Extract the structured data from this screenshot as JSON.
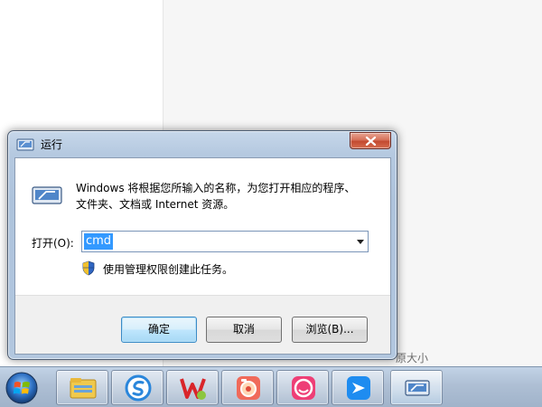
{
  "desktop": {
    "partial_text": "原大小"
  },
  "dialog": {
    "title": "运行",
    "description_line1": "Windows 将根据您所输入的名称，为您打开相应的程序、",
    "description_line2": "文件夹、文档或 Internet 资源。",
    "open_label": "打开(O):",
    "input_value": "cmd",
    "admin_note": "使用管理权限创建此任务。",
    "buttons": {
      "ok": "确定",
      "cancel": "取消",
      "browse": "浏览(B)..."
    }
  },
  "taskbar": {
    "items": [
      {
        "icon": "file-explorer-icon"
      },
      {
        "icon": "sogou-browser-icon"
      },
      {
        "icon": "wps-office-icon"
      },
      {
        "icon": "photo-app-icon"
      },
      {
        "icon": "pink-app-icon"
      },
      {
        "icon": "bird-app-icon"
      },
      {
        "icon": "run-dialog-icon",
        "active": true
      }
    ]
  },
  "colors": {
    "selection": "#3399ff",
    "dialog_frame": "#aec3dc",
    "close_button": "#c34a30",
    "taskbar": "#aebfd4"
  }
}
